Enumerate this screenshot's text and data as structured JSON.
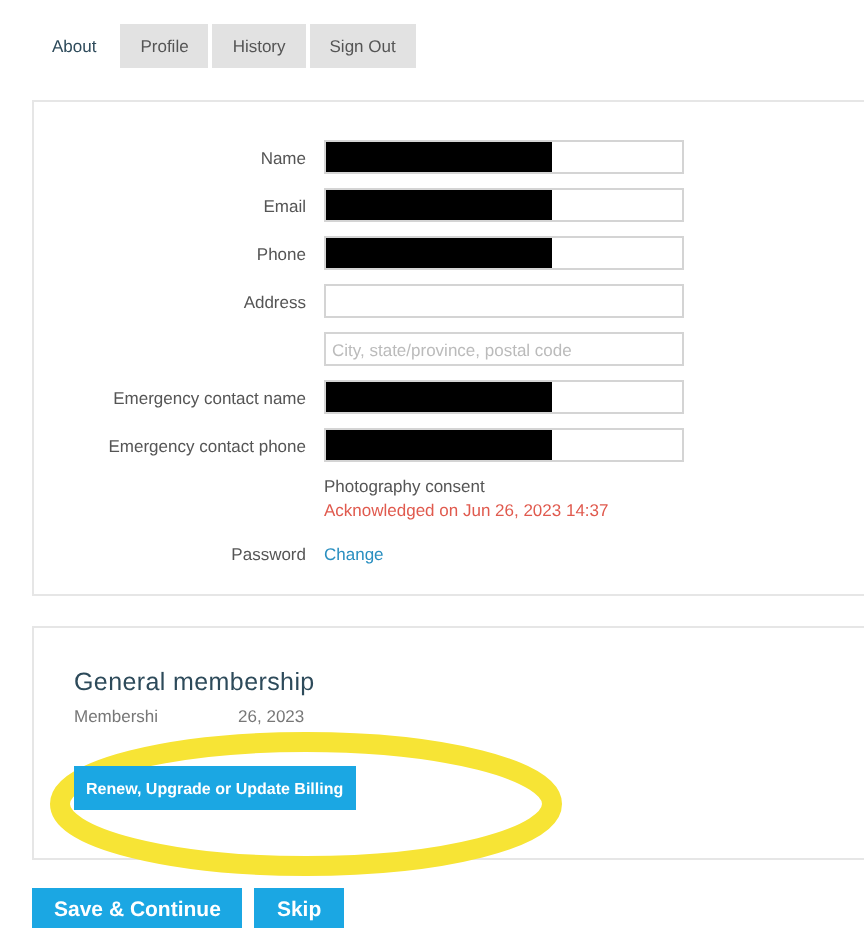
{
  "tabs": [
    {
      "label": "About",
      "selected": true
    },
    {
      "label": "Profile",
      "selected": false
    },
    {
      "label": "History",
      "selected": false
    },
    {
      "label": "Sign Out",
      "selected": false
    }
  ],
  "fields": [
    {
      "label": "Name",
      "kind": "redacted"
    },
    {
      "label": "Email",
      "kind": "redacted"
    },
    {
      "label": "Phone",
      "kind": "redacted"
    },
    {
      "label": "Address",
      "kind": "empty"
    },
    {
      "kind": "placeholder",
      "placeholder": "City, state/province, postal code"
    },
    {
      "label": "Emergency contact name",
      "kind": "redacted"
    },
    {
      "label": "Emergency contact phone",
      "kind": "redacted"
    }
  ],
  "consent": {
    "title": "Photography consent",
    "status": "Acknowledged on Jun 26, 2023 14:37"
  },
  "password": {
    "label": "Password",
    "link": "Change"
  },
  "membership": {
    "title": "General membership",
    "note_start": "Membershi",
    "note_end": "26, 2023",
    "button": "Renew, Upgrade or Update Billing",
    "highlighted": true
  },
  "buttons": [
    "Save & Continue",
    "Skip"
  ]
}
